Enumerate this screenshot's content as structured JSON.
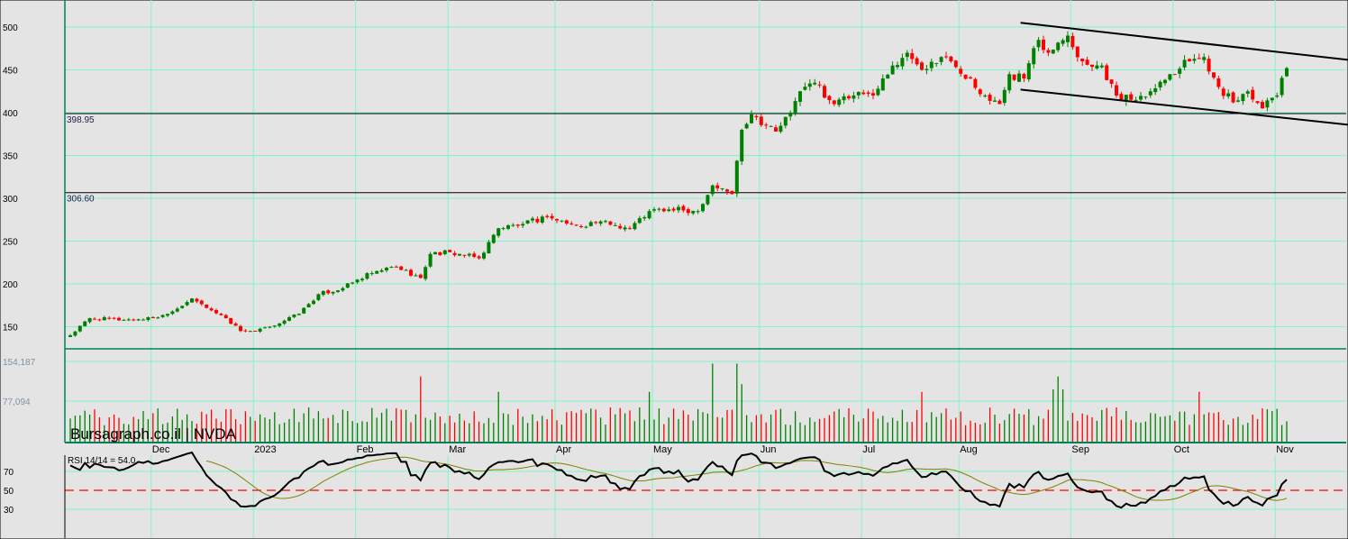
{
  "chart_data": {
    "type": "candlestick",
    "symbol": "NVDA",
    "watermark": "Bursagraph.co.il | NVDA",
    "price_axis": {
      "ticks": [
        500,
        450,
        400,
        350,
        300,
        250,
        200,
        150
      ],
      "range": [
        118,
        532
      ]
    },
    "volume_axis": {
      "ticks": [
        "154,187",
        "77,094"
      ],
      "tick_values": [
        154187,
        77094
      ]
    },
    "months": [
      "Dec",
      "2023",
      "Feb",
      "Mar",
      "Apr",
      "May",
      "Jun",
      "Jul",
      "Aug",
      "Sep",
      "Oct",
      "Nov"
    ],
    "month_start_index": [
      17,
      38,
      59,
      78,
      100,
      120,
      142,
      163,
      183,
      206,
      227,
      248
    ],
    "horizontal_levels": [
      {
        "value": 398.95,
        "label": "398.95"
      },
      {
        "value": 306.6,
        "label": "306.60"
      }
    ],
    "trend_channel": {
      "upper": [
        [
          199,
          505
        ],
        [
          260,
          455
        ]
      ],
      "lower": [
        [
          199,
          427
        ],
        [
          261,
          379
        ]
      ]
    },
    "close_path": [
      [
        0,
        140
      ],
      [
        4,
        160
      ],
      [
        11,
        158
      ],
      [
        17,
        160
      ],
      [
        20,
        165
      ],
      [
        25,
        183
      ],
      [
        28,
        172
      ],
      [
        32,
        160
      ],
      [
        35,
        145
      ],
      [
        38,
        145
      ],
      [
        41,
        150
      ],
      [
        47,
        165
      ],
      [
        51,
        188
      ],
      [
        56,
        195
      ],
      [
        59,
        205
      ],
      [
        63,
        215
      ],
      [
        67,
        220
      ],
      [
        72,
        207
      ],
      [
        74,
        235
      ],
      [
        78,
        237
      ],
      [
        84,
        230
      ],
      [
        88,
        265
      ],
      [
        93,
        270
      ],
      [
        98,
        278
      ],
      [
        104,
        268
      ],
      [
        109,
        273
      ],
      [
        115,
        265
      ],
      [
        119,
        285
      ],
      [
        123,
        287
      ],
      [
        129,
        285
      ],
      [
        132,
        315
      ],
      [
        136,
        305
      ],
      [
        138,
        380
      ],
      [
        140,
        398
      ],
      [
        145,
        378
      ],
      [
        148,
        400
      ],
      [
        150,
        425
      ],
      [
        153,
        435
      ],
      [
        157,
        410
      ],
      [
        161,
        420
      ],
      [
        165,
        420
      ],
      [
        169,
        455
      ],
      [
        172,
        470
      ],
      [
        175,
        450
      ],
      [
        179,
        465
      ],
      [
        181,
        460
      ],
      [
        185,
        440
      ],
      [
        188,
        420
      ],
      [
        191,
        410
      ],
      [
        193,
        445
      ],
      [
        196,
        440
      ],
      [
        199,
        485
      ],
      [
        201,
        470
      ],
      [
        205,
        490
      ],
      [
        208,
        460
      ],
      [
        212,
        455
      ],
      [
        215,
        420
      ],
      [
        218,
        415
      ],
      [
        222,
        425
      ],
      [
        226,
        445
      ],
      [
        230,
        460
      ],
      [
        233,
        465
      ],
      [
        236,
        430
      ],
      [
        239,
        412
      ],
      [
        242,
        425
      ],
      [
        245,
        405
      ],
      [
        248,
        420
      ],
      [
        250,
        452
      ]
    ],
    "rsi": {
      "label": "RSI 14/14 = 54.0",
      "period": 14,
      "ma_period": 14,
      "value": 54.0,
      "ticks": [
        70,
        50,
        30
      ],
      "midline": 50
    },
    "colors": {
      "up": "#008000",
      "down": "#ff0000",
      "grid": "#7ff5c8",
      "rsi": "#000000",
      "rsi_ma": "#808000",
      "midline": "#ff0000",
      "background": "#e4e4e4"
    }
  }
}
